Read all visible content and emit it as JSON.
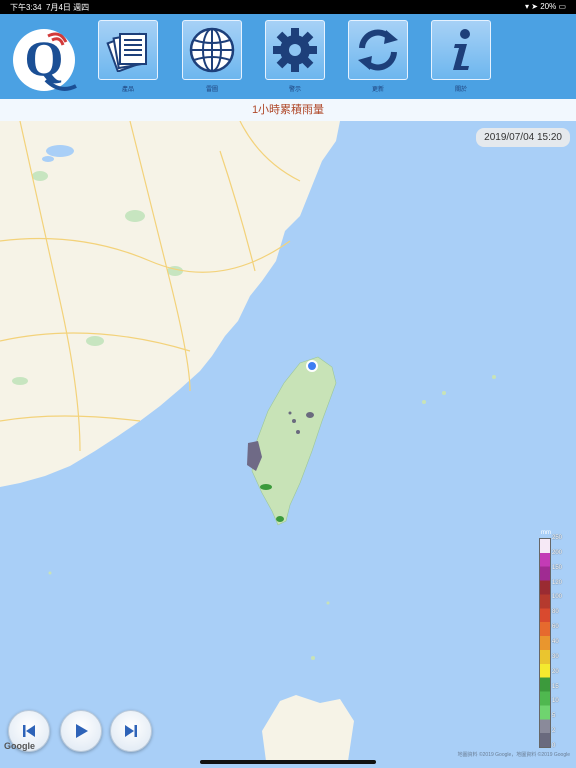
{
  "status_bar": {
    "time": "下午3:34",
    "date": "7月4日 週四",
    "battery": "20%"
  },
  "toolbar": {
    "items": [
      {
        "label": "產品",
        "icon": "newspaper-icon"
      },
      {
        "label": "雷圖",
        "icon": "globe-icon"
      },
      {
        "label": "警示",
        "icon": "gear-icon"
      },
      {
        "label": "更新",
        "icon": "refresh-icon"
      },
      {
        "label": "關於",
        "icon": "info-icon"
      }
    ]
  },
  "map": {
    "title": "1小時累積雨量",
    "timestamp": "2019/07/04 15:20",
    "attribution_left": "Google",
    "attribution_right": "地圖資料 ©2019 Google，地圖資料 ©2019 Google"
  },
  "legend": {
    "unit": "mm",
    "ticks": [
      "250",
      "200",
      "150",
      "120",
      "100",
      "80",
      "60",
      "40",
      "30",
      "20",
      "15",
      "10",
      "5",
      "2",
      "0"
    ],
    "colors": [
      "#f6e9f6",
      "#c33bb6",
      "#a02b92",
      "#9a2b32",
      "#b53a2e",
      "#d94a2f",
      "#e66a2e",
      "#e9962e",
      "#eac52f",
      "#f4ea2f",
      "#3c9a3c",
      "#4fb84f",
      "#6fd46f",
      "#8a8a9a",
      "#6a6a7e"
    ]
  },
  "playback": {
    "prev": "previous-frame",
    "play": "play",
    "next": "next-frame"
  }
}
